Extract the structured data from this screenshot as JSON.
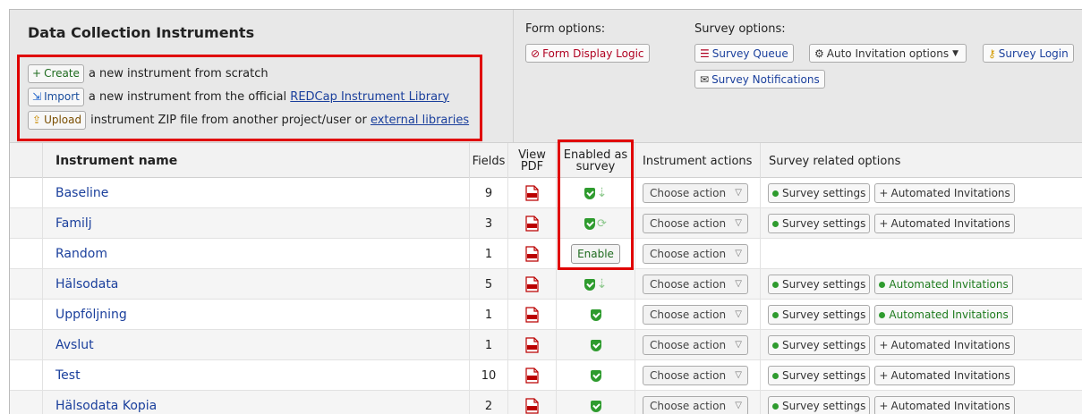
{
  "header": {
    "title": "Data Collection Instruments",
    "create_label": "Create",
    "create_text": "a new instrument from scratch",
    "import_label": "Import",
    "import_text": "a new instrument from the official",
    "import_link": "REDCap Instrument Library",
    "upload_label": "Upload",
    "upload_text": "instrument ZIP file from another project/user or",
    "upload_link": "external libraries"
  },
  "form_options": {
    "label": "Form options:",
    "display_logic": "Form Display Logic"
  },
  "survey_options": {
    "label": "Survey options:",
    "queue": "Survey Queue",
    "auto_invitation": "Auto Invitation options",
    "login": "Survey Login",
    "notifications": "Survey Notifications"
  },
  "table": {
    "col_name": "Instrument name",
    "col_fields": "Fields",
    "col_pdf_1": "View",
    "col_pdf_2": "PDF",
    "col_survey_1": "Enabled as",
    "col_survey_2": "survey",
    "col_actions": "Instrument actions",
    "col_related": "Survey related options",
    "choose_action": "Choose action",
    "enable_label": "Enable",
    "survey_settings": "Survey settings",
    "automated_invitations": "Automated Invitations",
    "rows": [
      {
        "name": "Baseline",
        "fields": "9",
        "survey": "enabled-arrow",
        "invitations": "plus"
      },
      {
        "name": "Familj",
        "fields": "3",
        "survey": "enabled-repeat",
        "invitations": "plus"
      },
      {
        "name": "Random",
        "fields": "1",
        "survey": "disabled",
        "invitations": "none"
      },
      {
        "name": "Hälsodata",
        "fields": "5",
        "survey": "enabled-arrow",
        "invitations": "active"
      },
      {
        "name": "Uppföljning",
        "fields": "1",
        "survey": "enabled",
        "invitations": "active"
      },
      {
        "name": "Avslut",
        "fields": "1",
        "survey": "enabled",
        "invitations": "plus"
      },
      {
        "name": "Test",
        "fields": "10",
        "survey": "enabled",
        "invitations": "plus"
      },
      {
        "name": "Hälsodata Kopia",
        "fields": "2",
        "survey": "enabled",
        "invitations": "plus"
      }
    ]
  },
  "colors": {
    "link": "#1a3f9c",
    "highlight": "#e00000",
    "enabled_green": "#2e9b2e"
  }
}
